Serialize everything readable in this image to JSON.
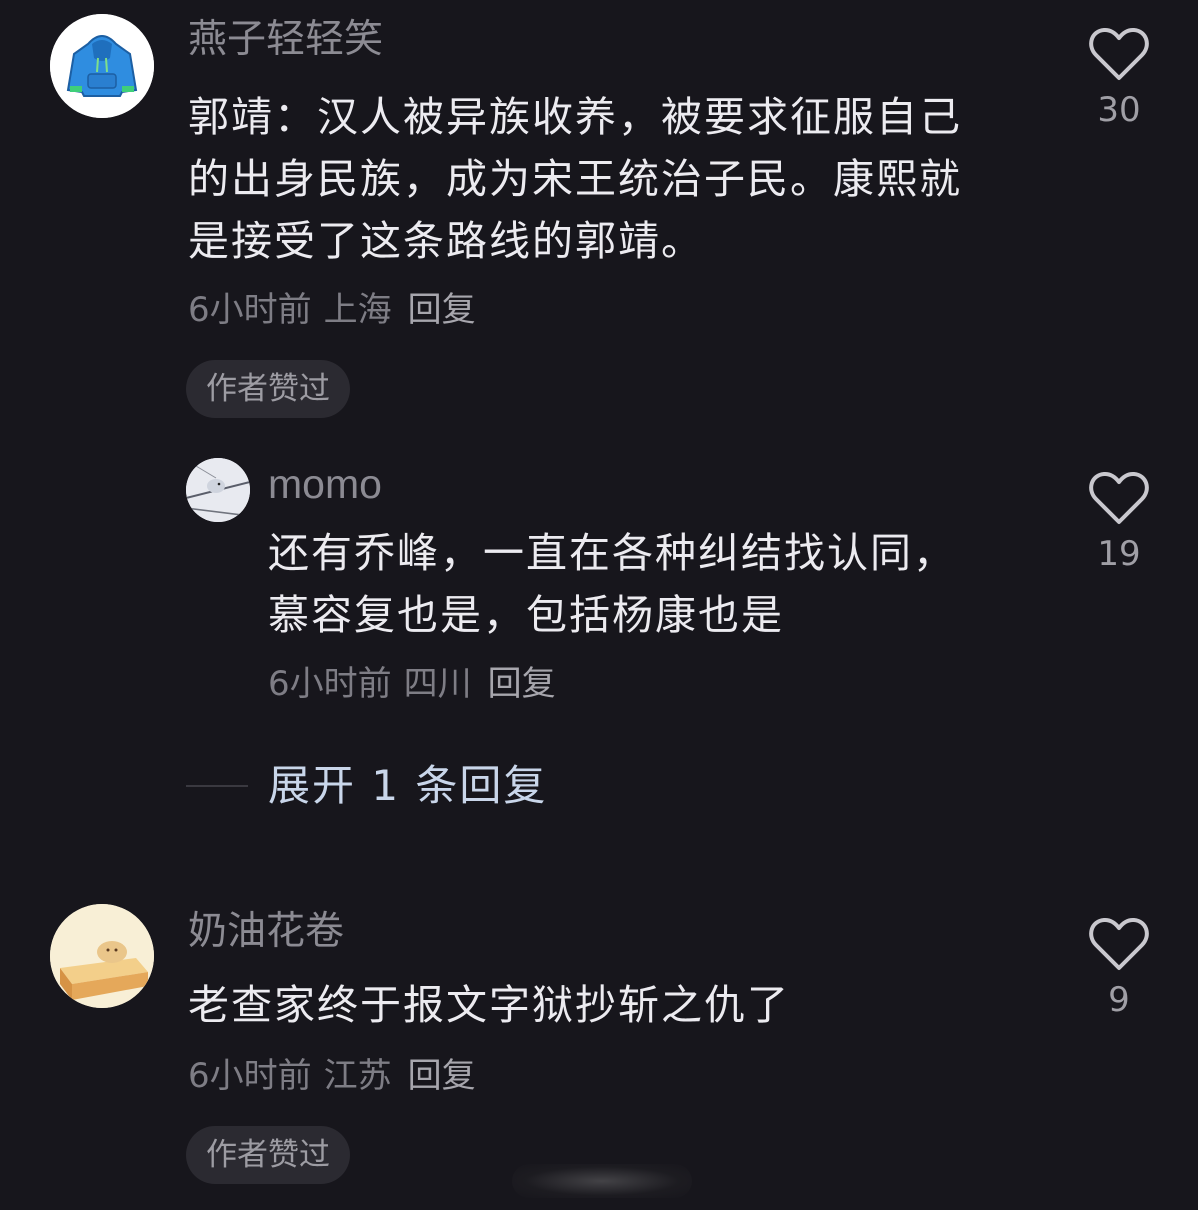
{
  "comments": [
    {
      "username": "燕子轻轻笑",
      "avatar_icon": "hoodie-avatar-icon",
      "body_lines": [
        "郭靖：汉人被异族收养，被要求征服自己",
        "的出身民族，成为宋王统治子民。康熙就",
        "是接受了这条路线的郭靖。"
      ],
      "time": "6小时前",
      "location": "上海",
      "reply_label": "回复",
      "badge": "作者赞过",
      "like_icon": "heart-outline-icon",
      "likes": "30"
    },
    {
      "username": "momo",
      "avatar_icon": "bird-photo-avatar-icon",
      "body_lines": [
        "还有乔峰，一直在各种纠结找认同，",
        "慕容复也是，包括杨康也是"
      ],
      "time": "6小时前",
      "location": "四川",
      "reply_label": "回复",
      "like_icon": "heart-outline-icon",
      "likes": "19"
    },
    {
      "username": "奶油花卷",
      "avatar_icon": "bread-avatar-icon",
      "body_lines": [
        "老查家终于报文字狱抄斩之仇了"
      ],
      "time": "6小时前",
      "location": "江苏",
      "reply_label": "回复",
      "badge": "作者赞过",
      "like_icon": "heart-outline-icon",
      "likes": "9"
    }
  ],
  "expand_replies": {
    "label": "展开 1 条回复"
  },
  "colors": {
    "background": "#17161c",
    "primary_text": "#ecebf0",
    "secondary_text": "#8c8b93",
    "expand_link": "#c9d6ea",
    "badge_bg": "#2b2a31"
  }
}
